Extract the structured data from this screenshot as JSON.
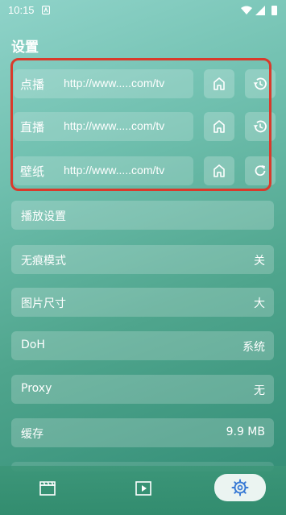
{
  "status": {
    "time": "10:15"
  },
  "title": "设置",
  "url_rows": [
    {
      "label": "点播",
      "value": "http://www.....com/tv",
      "action_icon": "history-icon"
    },
    {
      "label": "直播",
      "value": "http://www.....com/tv",
      "action_icon": "history-icon"
    },
    {
      "label": "壁纸",
      "value": "http://www.....com/tv",
      "action_icon": "refresh-icon"
    }
  ],
  "settings": [
    {
      "label": "播放设置",
      "value": ""
    },
    {
      "label": "无痕模式",
      "value": "关"
    },
    {
      "label": "图片尺寸",
      "value": "大"
    },
    {
      "label": "DoH",
      "value": "系统"
    },
    {
      "label": "Proxy",
      "value": "无"
    },
    {
      "label": "缓存",
      "value": "9.9 MB"
    }
  ],
  "nav": {
    "items": [
      {
        "icon": "movie-clapper-icon",
        "active": false
      },
      {
        "icon": "play-box-icon",
        "active": false
      },
      {
        "icon": "settings-gear-icon",
        "active": true
      }
    ]
  },
  "colors": {
    "highlight": "#d93a2b",
    "active_nav_icon": "#3a7bd5"
  }
}
